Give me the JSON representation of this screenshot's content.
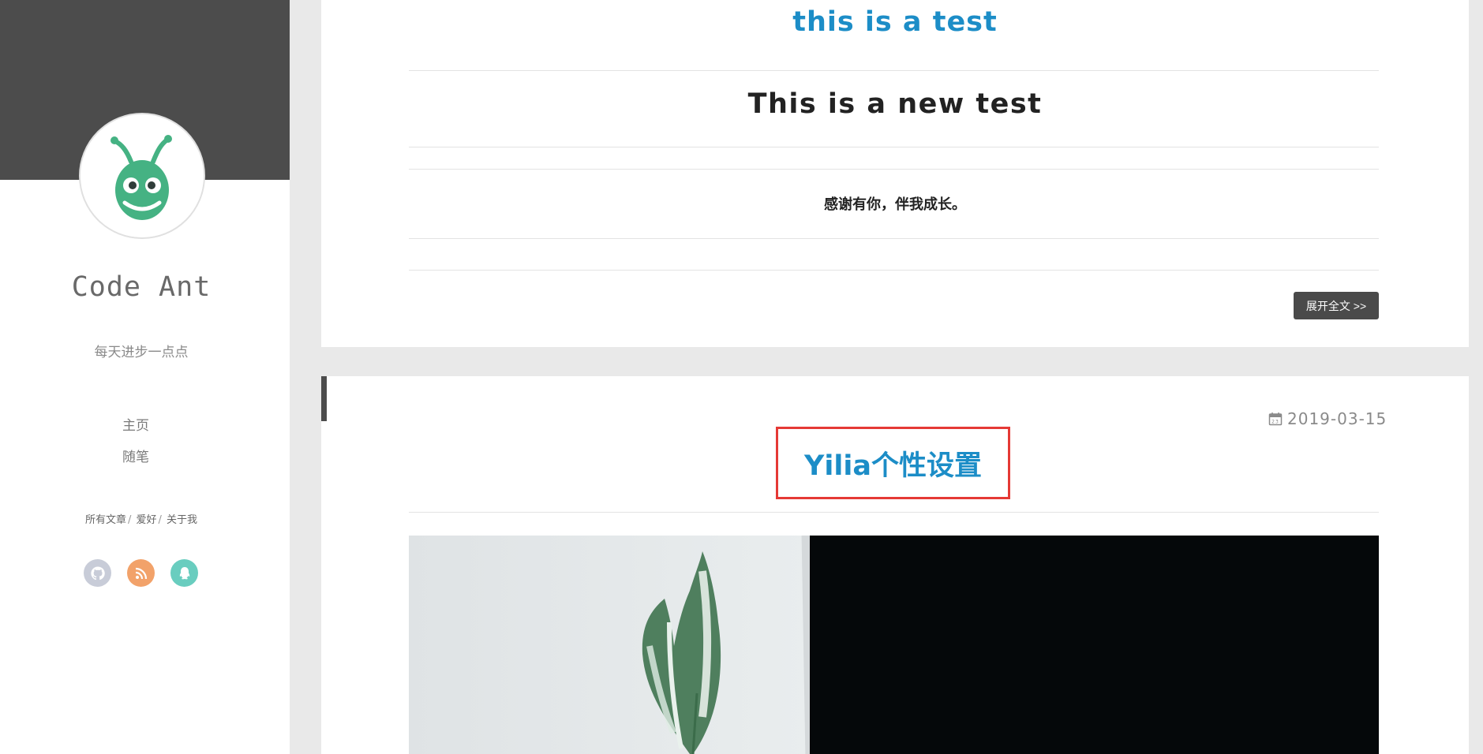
{
  "sidebar": {
    "title": "Code Ant",
    "subtitle": "每天进步一点点",
    "nav": [
      {
        "label": "主页"
      },
      {
        "label": "随笔"
      }
    ],
    "links": [
      {
        "label": "所有文章"
      },
      {
        "label": "爱好"
      },
      {
        "label": "关于我"
      }
    ],
    "social": [
      {
        "icon": "github-icon",
        "color": "#c8ccd8"
      },
      {
        "icon": "rss-icon",
        "color": "#f2a26a"
      },
      {
        "icon": "qq-icon",
        "color": "#69cdbf"
      }
    ],
    "avatar_icon": "ant-logo"
  },
  "articles": [
    {
      "title": "this is a test",
      "heading": "This is a new test",
      "quote": "感谢有你，伴我成长。",
      "more_label": "展开全文 >>"
    },
    {
      "date": "2019-03-15",
      "title": "Yilia个性设置",
      "image": "leaf-photo"
    }
  ],
  "colors": {
    "accent": "#1c8dc7",
    "sidebar_banner": "#4c4c4c",
    "highlight_box": "#e53935"
  }
}
